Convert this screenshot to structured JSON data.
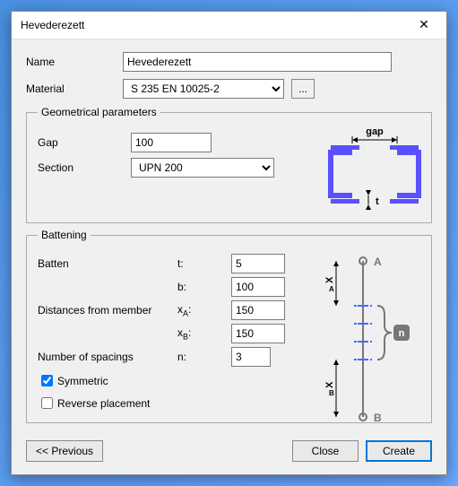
{
  "window": {
    "title": "Hevederezett"
  },
  "fields": {
    "name_label": "Name",
    "name_value": "Hevederezett",
    "material_label": "Material",
    "material_value": "S 235 EN 10025-2",
    "material_more": "..."
  },
  "geo": {
    "legend": "Geometrical parameters",
    "gap_label": "Gap",
    "gap_value": "100",
    "section_label": "Section",
    "section_value": "UPN 200",
    "diagram": {
      "gap_text": "gap",
      "t_text": "t"
    }
  },
  "bat": {
    "legend": "Battening",
    "batten_label": "Batten",
    "t_lbl": "t:",
    "t_val": "5",
    "b_lbl": "b:",
    "b_val": "100",
    "dist_label": "Distances from member",
    "xa_lbl": "x",
    "xa_sub": "A",
    "xa_colon": ":",
    "xa_val": "150",
    "xb_lbl": "x",
    "xb_sub": "B",
    "xb_colon": ":",
    "xb_val": "150",
    "spac_label": "Number of spacings",
    "n_lbl": "n:",
    "n_val": "3",
    "symmetric": "Symmetric",
    "symmetric_checked": true,
    "reverse": "Reverse placement",
    "reverse_checked": false,
    "diagram": {
      "A": "A",
      "B": "B",
      "xA": "X",
      "xA_sub": "A",
      "xB": "X",
      "xB_sub": "B",
      "n": "n"
    }
  },
  "footer": {
    "prev": "<< Previous",
    "close": "Close",
    "create": "Create"
  }
}
